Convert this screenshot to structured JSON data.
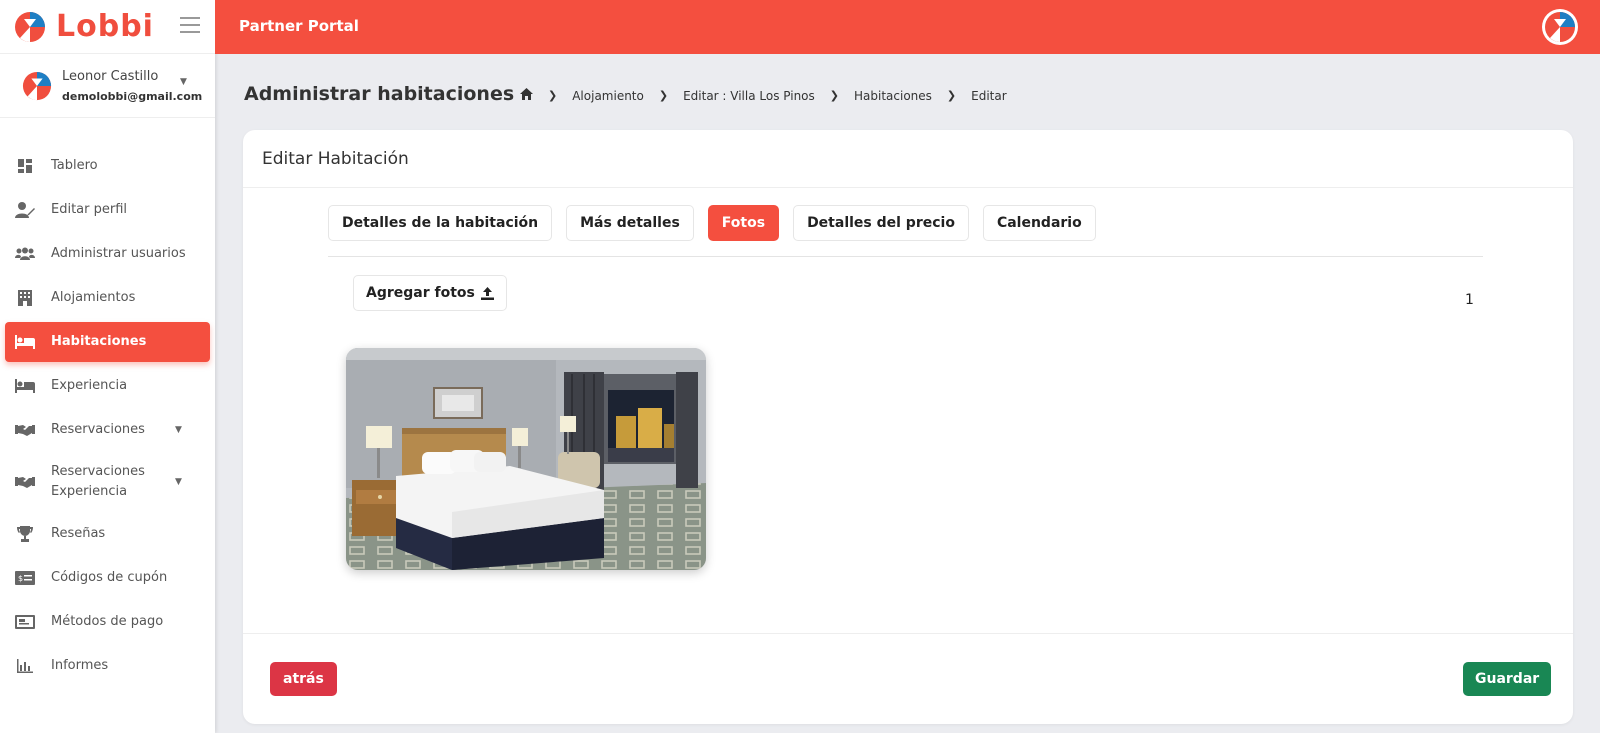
{
  "brand": {
    "name": "Lobbi"
  },
  "user": {
    "name": "Leonor Castillo",
    "email": "demolobbi@gmail.com"
  },
  "sidebar": {
    "items": [
      {
        "label": "Tablero",
        "icon": "dashboard-icon"
      },
      {
        "label": "Editar perfil",
        "icon": "user-edit-icon"
      },
      {
        "label": "Administrar usuarios",
        "icon": "users-icon"
      },
      {
        "label": "Alojamientos",
        "icon": "building-icon"
      },
      {
        "label": "Habitaciones",
        "icon": "bed-icon",
        "active": true
      },
      {
        "label": "Experiencia",
        "icon": "bed-icon"
      },
      {
        "label": "Reservaciones",
        "icon": "handshake-icon",
        "has_submenu": true
      },
      {
        "label_line1": "Reservaciones",
        "label_line2": "Experiencia",
        "icon": "handshake-icon",
        "has_submenu": true
      },
      {
        "label": "Reseñas",
        "icon": "trophy-icon"
      },
      {
        "label": "Códigos de cupón",
        "icon": "coupon-icon"
      },
      {
        "label": "Métodos de pago",
        "icon": "payment-icon"
      },
      {
        "label": "Informes",
        "icon": "bar-chart-icon"
      }
    ]
  },
  "topbar": {
    "title": "Partner Portal"
  },
  "page": {
    "title": "Administrar habitaciones",
    "breadcrumb": [
      "Alojamiento",
      "Editar : Villa Los Pinos",
      "Habitaciones",
      "Editar"
    ]
  },
  "card": {
    "title": "Editar Habitación",
    "tabs": [
      {
        "label": "Detalles de la habitación"
      },
      {
        "label": "Más detalles"
      },
      {
        "label": "Fotos",
        "active": true
      },
      {
        "label": "Detalles del precio"
      },
      {
        "label": "Calendario"
      }
    ],
    "add_photos_label": "Agregar fotos",
    "photo_count": "1",
    "back_label": "atrás",
    "save_label": "Guardar"
  },
  "colors": {
    "primary": "#f44f3f",
    "back": "#dc3545",
    "save": "#198754",
    "background": "#ebecf0"
  }
}
